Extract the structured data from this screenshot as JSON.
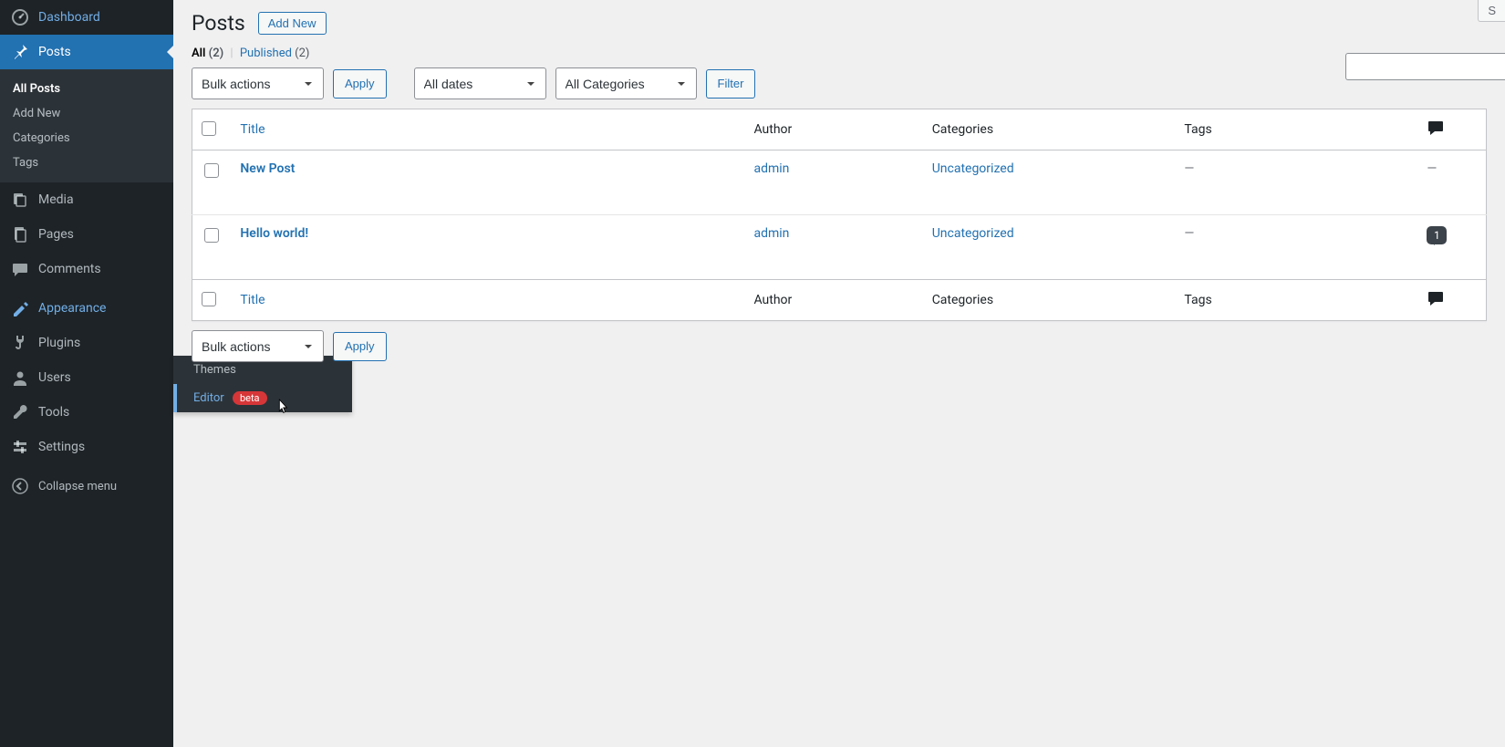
{
  "sidebar": {
    "dashboard": "Dashboard",
    "posts": "Posts",
    "posts_sub": {
      "all": "All Posts",
      "add": "Add New",
      "cat": "Categories",
      "tags": "Tags"
    },
    "media": "Media",
    "pages": "Pages",
    "comments": "Comments",
    "appearance": "Appearance",
    "appearance_sub": {
      "themes": "Themes",
      "editor": "Editor",
      "beta": "beta"
    },
    "plugins": "Plugins",
    "users": "Users",
    "tools": "Tools",
    "settings": "Settings",
    "collapse": "Collapse menu"
  },
  "header": {
    "title": "Posts",
    "add_new": "Add New",
    "screen_options_label": "S"
  },
  "views": {
    "all_label": "All",
    "all_count": "(2)",
    "sep": "|",
    "published_label": "Published",
    "published_count": "(2)"
  },
  "filters": {
    "bulk": "Bulk actions",
    "apply": "Apply",
    "dates": "All dates",
    "cats": "All Categories",
    "filter": "Filter"
  },
  "columns": {
    "title": "Title",
    "author": "Author",
    "categories": "Categories",
    "tags": "Tags"
  },
  "rows": [
    {
      "title": "New Post",
      "author": "admin",
      "categories": "Uncategorized",
      "tags": "—",
      "comments": "—"
    },
    {
      "title": "Hello world!",
      "author": "admin",
      "categories": "Uncategorized",
      "tags": "—",
      "comments": "1"
    }
  ],
  "bottom": {
    "bulk": "Bulk actions",
    "apply": "Apply"
  }
}
